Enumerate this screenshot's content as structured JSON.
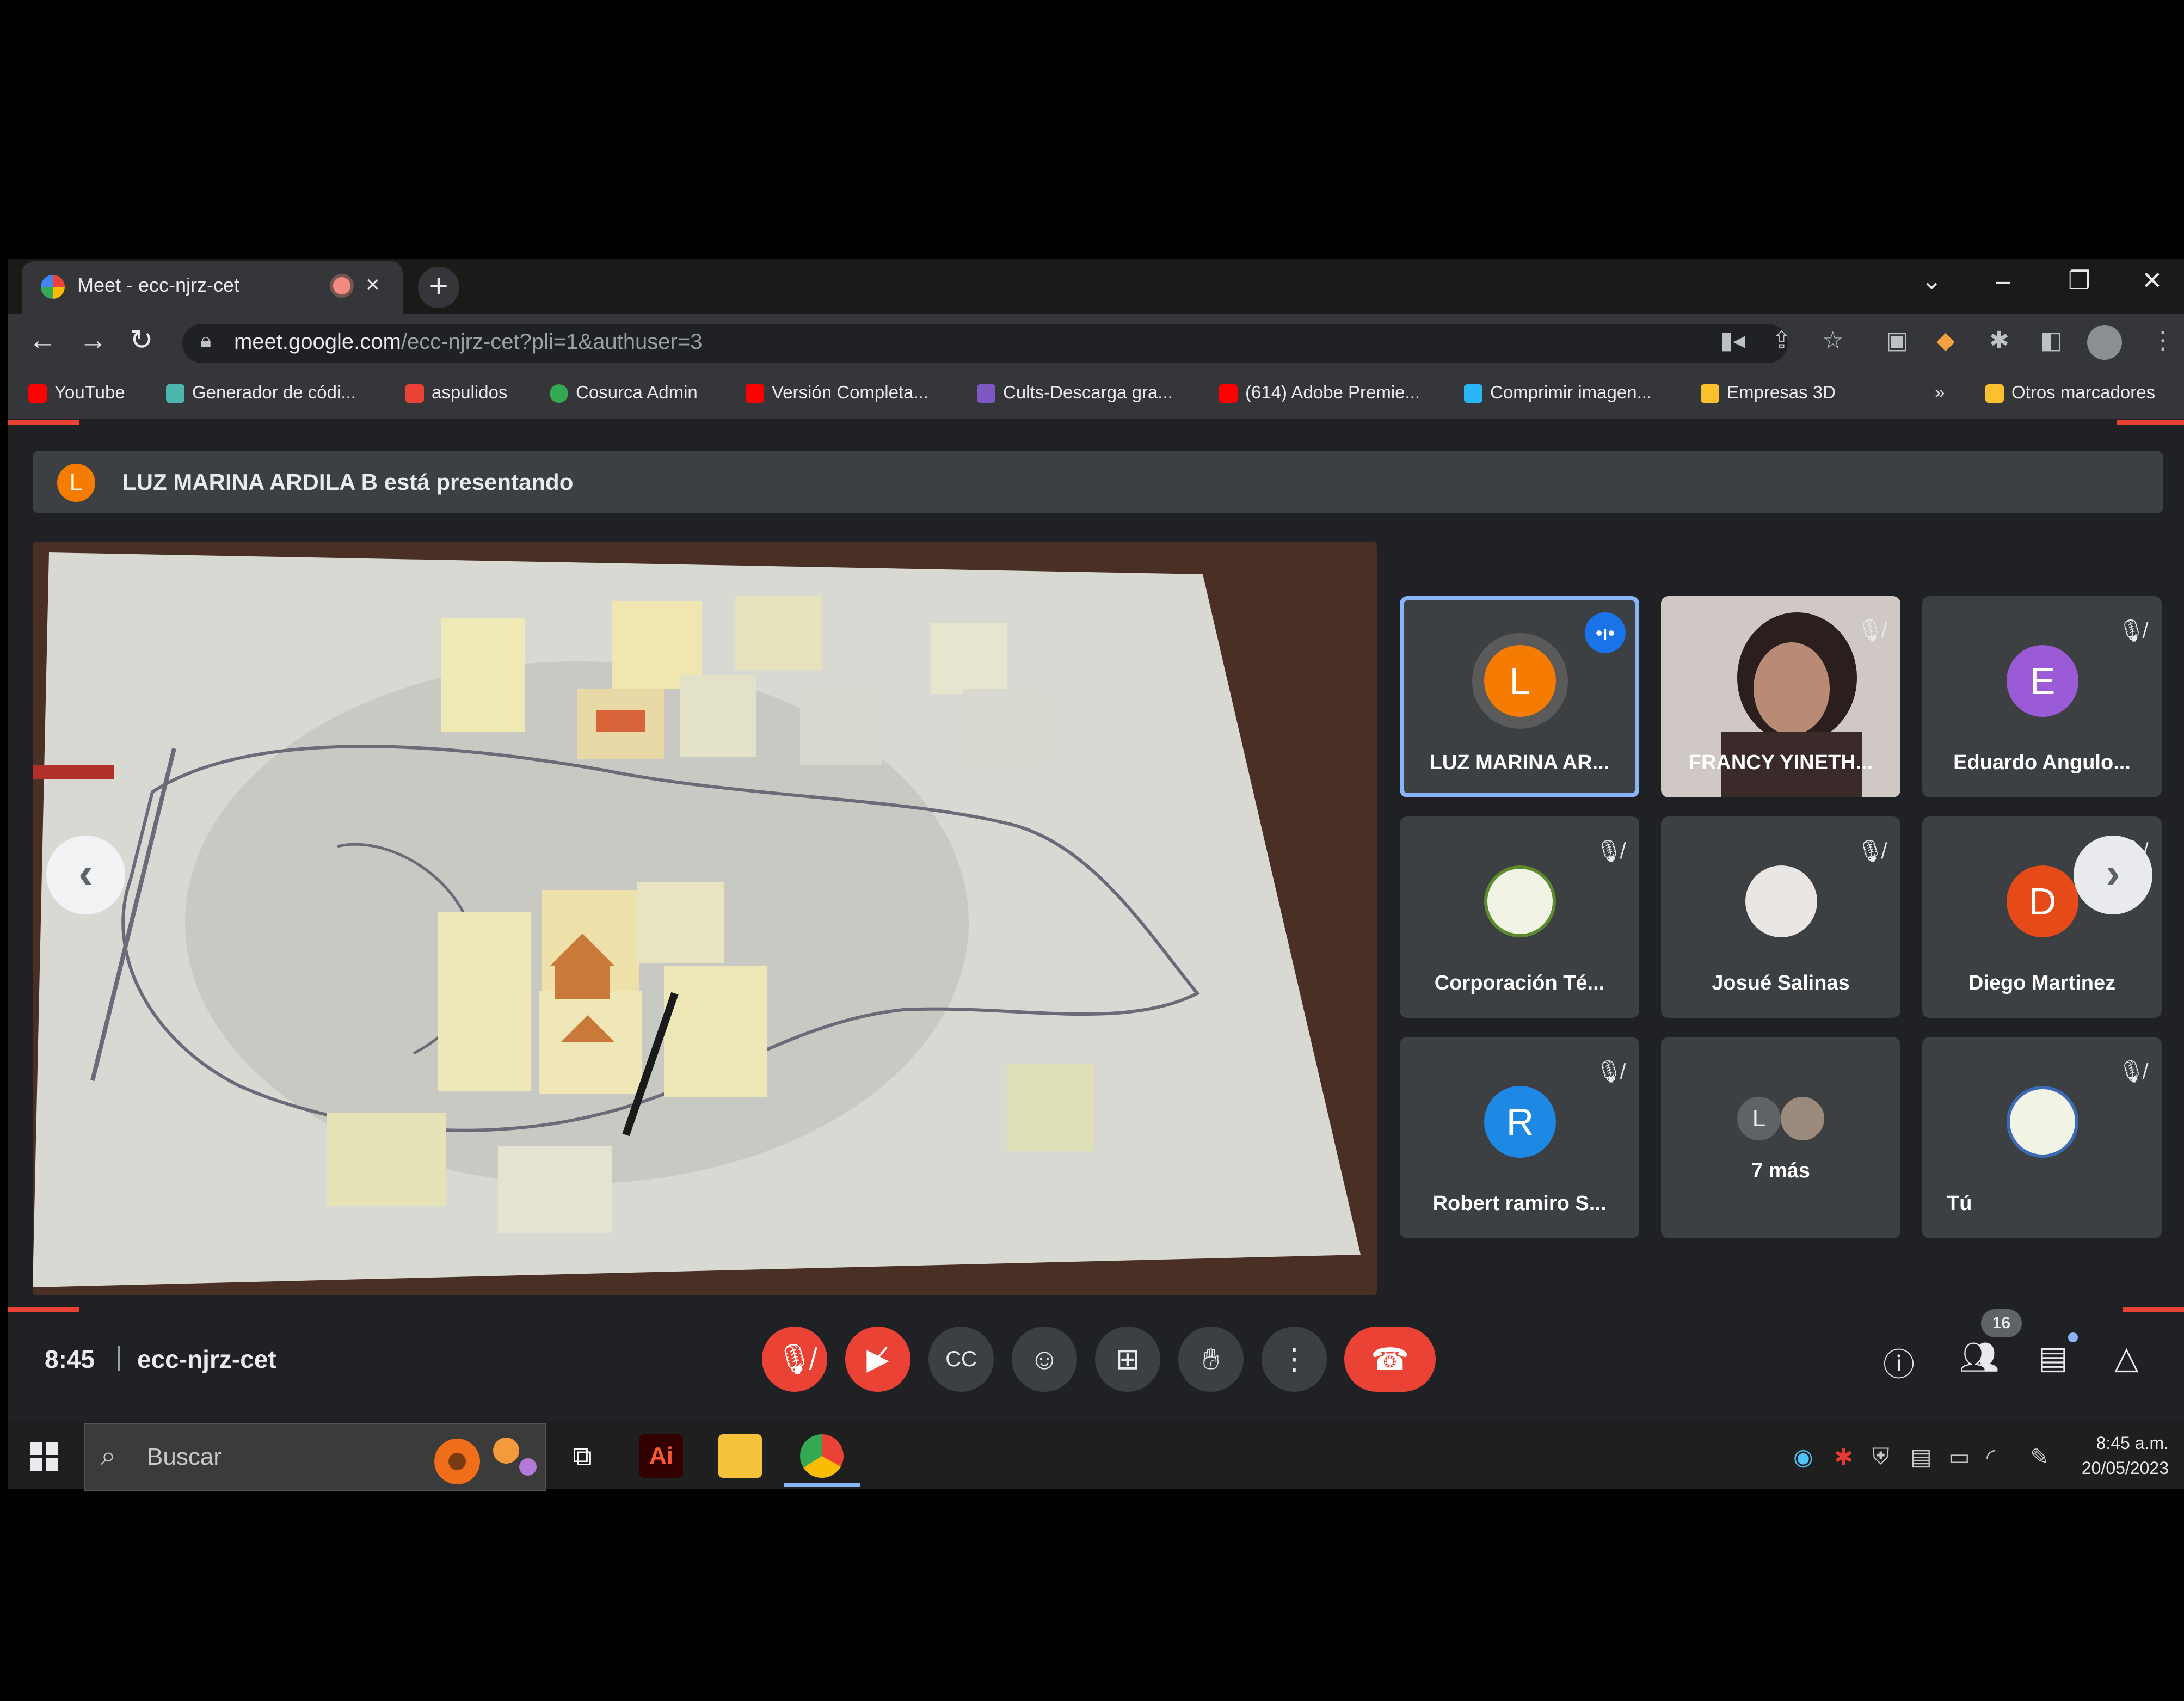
{
  "browser": {
    "tab_title": "Meet - ecc-njrz-cet",
    "url_host": "meet.google.com",
    "url_path": "/ecc-njrz-cet?pli=1&authuser=3",
    "bookmarks": [
      {
        "label": "YouTube",
        "color": "#ff0000"
      },
      {
        "label": "Generador de códi...",
        "color": "#4db6ac"
      },
      {
        "label": "aspulidos",
        "color": "#ea4335"
      },
      {
        "label": "Cosurca Admin",
        "color": "#34a853"
      },
      {
        "label": "Versión Completa...",
        "color": "#ff0000"
      },
      {
        "label": "Cults-Descarga gra...",
        "color": "#7e57c2"
      },
      {
        "label": "(614) Adobe Premie...",
        "color": "#ff0000"
      },
      {
        "label": "Comprimir imagen...",
        "color": "#29b6f6"
      },
      {
        "label": "Empresas 3D",
        "color": "#fbc02d"
      }
    ],
    "other_bookmarks": "Otros marcadores",
    "overflow": "»"
  },
  "meet": {
    "presenter_initial": "L",
    "presenter_banner": "LUZ MARINA ARDILA B está presentando",
    "participants": [
      {
        "name": "LUZ MARINA AR...",
        "initial": "L",
        "color": "#f57c00"
      },
      {
        "name": "FRANCY YINETH..."
      },
      {
        "name": "Eduardo Angulo...",
        "initial": "E",
        "color": "#9c5bd6"
      },
      {
        "name": "Corporación Té..."
      },
      {
        "name": "Josué Salinas"
      },
      {
        "name": "Diego Martinez",
        "initial": "D",
        "color": "#e64a19"
      },
      {
        "name": "Robert ramiro S...",
        "initial": "R",
        "color": "#1e88e5"
      },
      {
        "name": "7 más",
        "initial": "L"
      },
      {
        "name": "Tú"
      }
    ],
    "time": "8:45",
    "separator": "|",
    "meeting_code": "ecc-njrz-cet",
    "people_count": "16"
  },
  "taskbar": {
    "search_placeholder": "Buscar",
    "clock_time": "8:45 a.m.",
    "clock_date": "20/05/2023"
  }
}
